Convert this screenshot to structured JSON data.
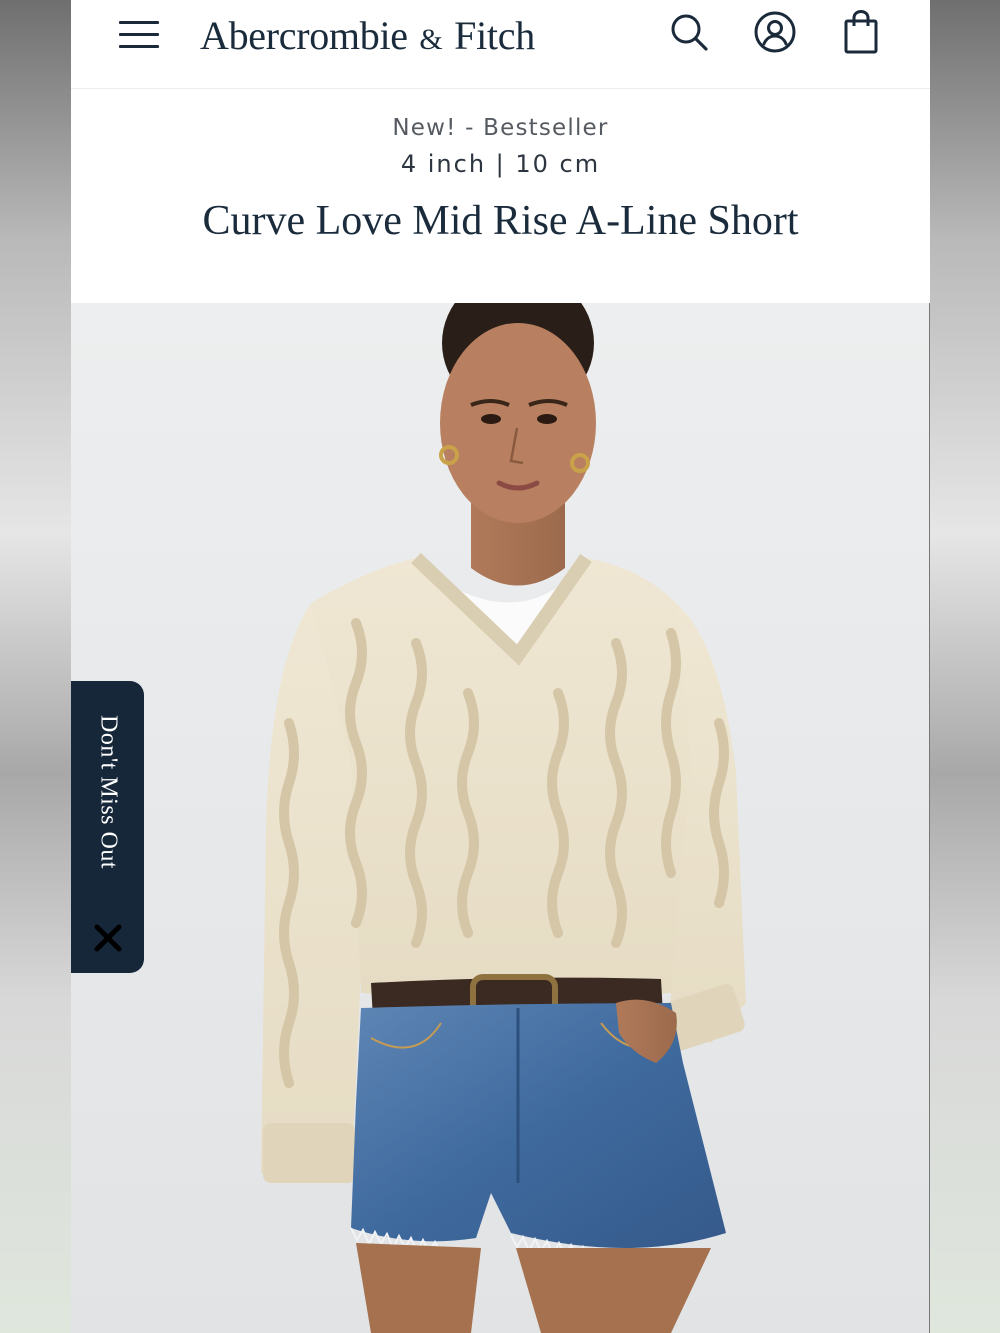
{
  "header": {
    "brand": "Abercrombie",
    "brand_amp": "&",
    "brand_rest": "Fitch",
    "icons": [
      "menu-icon",
      "search-icon",
      "account-icon",
      "shopping-bag-icon"
    ]
  },
  "product": {
    "badges": "New! - Bestseller",
    "inseam": "4 inch | 10 cm",
    "title": "Curve Love Mid Rise A-Line Short"
  },
  "promo": {
    "label": "Don't Miss Out",
    "close_icon": "close-icon"
  },
  "colors": {
    "brand_navy": "#1a2b3c",
    "promo_bg": "#16273a",
    "badge_text": "#555b61"
  }
}
